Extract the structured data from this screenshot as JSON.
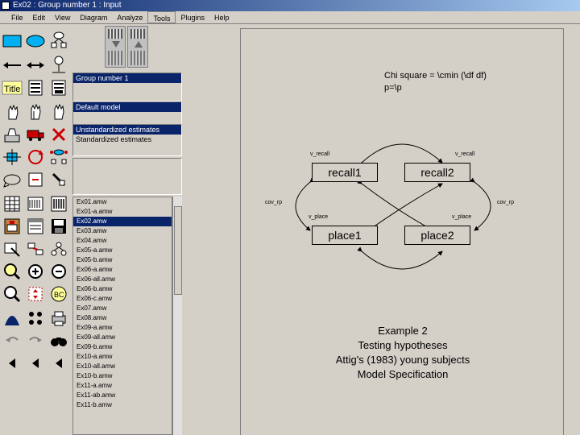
{
  "window": {
    "title": "Ex02 : Group number 1 : Input"
  },
  "menubar": {
    "items": [
      "File",
      "Edit",
      "View",
      "Diagram",
      "Analyze",
      "Tools",
      "Plugins",
      "Help"
    ]
  },
  "panels": {
    "groups": [
      "Group number 1"
    ],
    "models": [
      "Default model"
    ],
    "estimates": [
      "Unstandardized estimates",
      "Standardized estimates"
    ]
  },
  "files": [
    "Ex01.amw",
    "Ex01-a.amw",
    "Ex02.amw",
    "Ex03.amw",
    "Ex04.amw",
    "Ex05-a.amw",
    "Ex05-b.amw",
    "Ex06-a.amw",
    "Ex06-all.amw",
    "Ex06-b.amw",
    "Ex06-c.amw",
    "Ex07.amw",
    "Ex08.amw",
    "Ex09-a.amw",
    "Ex09-all.amw",
    "Ex09-b.amw",
    "Ex10-a.amw",
    "Ex10-all.amw",
    "Ex10-b.amw",
    "Ex11-a.amw",
    "Ex11-ab.amw",
    "Ex11-b.amw"
  ],
  "diagram": {
    "fit_text": [
      "Chi square = \\cmin (\\df df)",
      "p=\\p"
    ],
    "variables": {
      "recall1": "recall1",
      "recall2": "recall2",
      "place1": "place1",
      "place2": "place2"
    },
    "parameters": {
      "v_recall_left": "v_recall",
      "v_recall_right": "v_recall",
      "v_place_left": "v_place",
      "v_place_right": "v_place",
      "cov_rp_left": "cov_rp",
      "cov_rp_right": "cov_rp"
    },
    "caption": [
      "Example 2",
      "Testing hypotheses",
      "Attig's (1983) young subjects",
      "Model Specification"
    ]
  },
  "icons": {
    "toolbox": [
      "draw-observed-icon",
      "draw-unobserved-icon",
      "draw-latent-indicator-icon",
      "draw-path-icon",
      "draw-covariance-icon",
      "unique-variable-icon",
      "title-icon",
      "list-variables-model-icon",
      "list-variables-dataset-icon",
      "select-one-icon",
      "select-all-icon",
      "deselect-all-icon",
      "duplicate-icon",
      "move-icon",
      "erase-icon",
      "shape-change-icon",
      "rotate-icon",
      "reflect-icon",
      "move-parameters-icon",
      "scroll-icon",
      "touch-up-icon",
      "data-files-icon",
      "analysis-properties-icon",
      "calculate-estimates-icon",
      "view-text-icon",
      "copy-diagram-icon",
      "save-icon",
      "object-properties-icon",
      "drag-properties-icon",
      "preserve-symmetries-icon",
      "zoom-in-icon",
      "zoom-out-icon",
      "zoom-page-icon",
      "show-page-icon",
      "resize-icon",
      "bayesian-icon",
      "degrees-freedom-icon",
      "bootstrap-icon",
      "print-icon",
      "undo-icon",
      "redo-icon",
      "search-icon",
      "nav-left-icon",
      "nav-left2-icon",
      "nav-left3-icon"
    ]
  }
}
